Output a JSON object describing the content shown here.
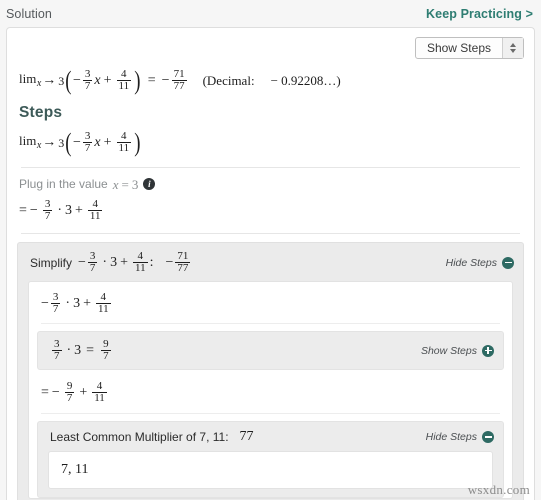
{
  "header": {
    "title": "Solution",
    "keep_practicing": "Keep Practicing >"
  },
  "toolbar": {
    "select_value": "Show Steps",
    "stepper_icon": "updown-arrows-icon"
  },
  "solution": {
    "lim_label": "lim",
    "lim_var": "x",
    "arrow": "→",
    "approach": "3",
    "open_paren": "(",
    "close_paren": ")",
    "minus": "−",
    "plus": "+",
    "equals": "=",
    "colon": ":",
    "dot": "·",
    "term1_num": "3",
    "term1_den": "7",
    "variable": "x",
    "term2_num": "4",
    "term2_den": "11",
    "result_num": "71",
    "result_den": "77",
    "decimal_label": "(Decimal:",
    "decimal_value": "− 0.92208…)"
  },
  "steps": {
    "heading": "Steps",
    "plug_text_before": "Plug in the value",
    "plug_var": "x",
    "plug_equals": "=",
    "plug_value": "3",
    "info_icon": "info-icon",
    "eq_line_lead": "="
  },
  "simplify_card": {
    "label": "Simplify",
    "colon": ":",
    "result_num": "71",
    "result_den": "77",
    "toggle_label": "Hide Steps",
    "toggle_icon": "minus-circle-icon"
  },
  "product_card": {
    "num": "3",
    "den": "7",
    "dot": "·",
    "factor": "3",
    "equals": "=",
    "res_num": "9",
    "res_den": "7",
    "toggle_label": "Show Steps",
    "toggle_icon": "plus-circle-icon"
  },
  "after_product": {
    "lead": "=",
    "minus": "−",
    "num1": "9",
    "den1": "7",
    "plus": "+",
    "num2": "4",
    "den2": "11"
  },
  "lcm_card": {
    "title": "Least Common Multiplier of 7, 11:",
    "value": "77",
    "toggle_label": "Hide Steps",
    "toggle_icon": "minus-circle-icon",
    "inner_value": "7, 11"
  },
  "watermark": "wsxdn.com",
  "colors": {
    "accent": "#2e7d72",
    "heading": "#3d5a58",
    "toggle_circle": "#2e6a63",
    "panel_bg": "#ffffff",
    "page_bg": "#f6f6f6",
    "card_bg": "#ebebeb"
  }
}
